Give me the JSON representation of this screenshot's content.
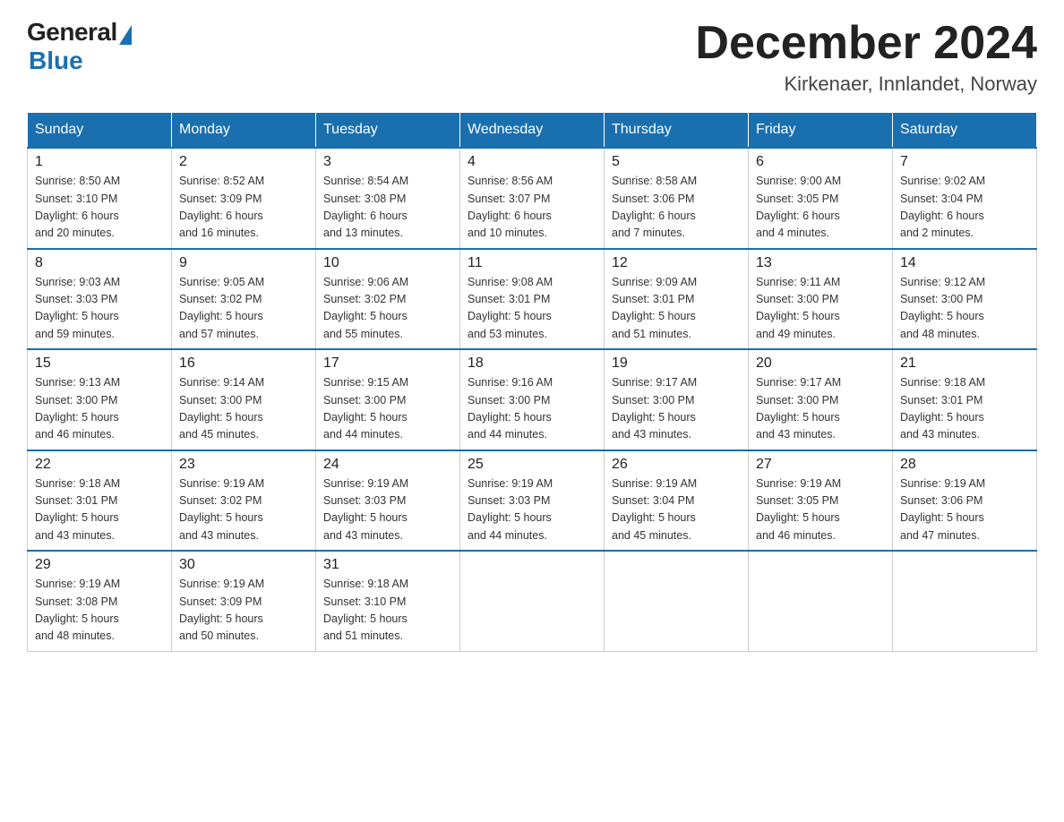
{
  "logo": {
    "general": "General",
    "blue": "Blue"
  },
  "title": "December 2024",
  "location": "Kirkenaer, Innlandet, Norway",
  "weekdays": [
    "Sunday",
    "Monday",
    "Tuesday",
    "Wednesday",
    "Thursday",
    "Friday",
    "Saturday"
  ],
  "weeks": [
    [
      {
        "day": "1",
        "info": "Sunrise: 8:50 AM\nSunset: 3:10 PM\nDaylight: 6 hours\nand 20 minutes."
      },
      {
        "day": "2",
        "info": "Sunrise: 8:52 AM\nSunset: 3:09 PM\nDaylight: 6 hours\nand 16 minutes."
      },
      {
        "day": "3",
        "info": "Sunrise: 8:54 AM\nSunset: 3:08 PM\nDaylight: 6 hours\nand 13 minutes."
      },
      {
        "day": "4",
        "info": "Sunrise: 8:56 AM\nSunset: 3:07 PM\nDaylight: 6 hours\nand 10 minutes."
      },
      {
        "day": "5",
        "info": "Sunrise: 8:58 AM\nSunset: 3:06 PM\nDaylight: 6 hours\nand 7 minutes."
      },
      {
        "day": "6",
        "info": "Sunrise: 9:00 AM\nSunset: 3:05 PM\nDaylight: 6 hours\nand 4 minutes."
      },
      {
        "day": "7",
        "info": "Sunrise: 9:02 AM\nSunset: 3:04 PM\nDaylight: 6 hours\nand 2 minutes."
      }
    ],
    [
      {
        "day": "8",
        "info": "Sunrise: 9:03 AM\nSunset: 3:03 PM\nDaylight: 5 hours\nand 59 minutes."
      },
      {
        "day": "9",
        "info": "Sunrise: 9:05 AM\nSunset: 3:02 PM\nDaylight: 5 hours\nand 57 minutes."
      },
      {
        "day": "10",
        "info": "Sunrise: 9:06 AM\nSunset: 3:02 PM\nDaylight: 5 hours\nand 55 minutes."
      },
      {
        "day": "11",
        "info": "Sunrise: 9:08 AM\nSunset: 3:01 PM\nDaylight: 5 hours\nand 53 minutes."
      },
      {
        "day": "12",
        "info": "Sunrise: 9:09 AM\nSunset: 3:01 PM\nDaylight: 5 hours\nand 51 minutes."
      },
      {
        "day": "13",
        "info": "Sunrise: 9:11 AM\nSunset: 3:00 PM\nDaylight: 5 hours\nand 49 minutes."
      },
      {
        "day": "14",
        "info": "Sunrise: 9:12 AM\nSunset: 3:00 PM\nDaylight: 5 hours\nand 48 minutes."
      }
    ],
    [
      {
        "day": "15",
        "info": "Sunrise: 9:13 AM\nSunset: 3:00 PM\nDaylight: 5 hours\nand 46 minutes."
      },
      {
        "day": "16",
        "info": "Sunrise: 9:14 AM\nSunset: 3:00 PM\nDaylight: 5 hours\nand 45 minutes."
      },
      {
        "day": "17",
        "info": "Sunrise: 9:15 AM\nSunset: 3:00 PM\nDaylight: 5 hours\nand 44 minutes."
      },
      {
        "day": "18",
        "info": "Sunrise: 9:16 AM\nSunset: 3:00 PM\nDaylight: 5 hours\nand 44 minutes."
      },
      {
        "day": "19",
        "info": "Sunrise: 9:17 AM\nSunset: 3:00 PM\nDaylight: 5 hours\nand 43 minutes."
      },
      {
        "day": "20",
        "info": "Sunrise: 9:17 AM\nSunset: 3:00 PM\nDaylight: 5 hours\nand 43 minutes."
      },
      {
        "day": "21",
        "info": "Sunrise: 9:18 AM\nSunset: 3:01 PM\nDaylight: 5 hours\nand 43 minutes."
      }
    ],
    [
      {
        "day": "22",
        "info": "Sunrise: 9:18 AM\nSunset: 3:01 PM\nDaylight: 5 hours\nand 43 minutes."
      },
      {
        "day": "23",
        "info": "Sunrise: 9:19 AM\nSunset: 3:02 PM\nDaylight: 5 hours\nand 43 minutes."
      },
      {
        "day": "24",
        "info": "Sunrise: 9:19 AM\nSunset: 3:03 PM\nDaylight: 5 hours\nand 43 minutes."
      },
      {
        "day": "25",
        "info": "Sunrise: 9:19 AM\nSunset: 3:03 PM\nDaylight: 5 hours\nand 44 minutes."
      },
      {
        "day": "26",
        "info": "Sunrise: 9:19 AM\nSunset: 3:04 PM\nDaylight: 5 hours\nand 45 minutes."
      },
      {
        "day": "27",
        "info": "Sunrise: 9:19 AM\nSunset: 3:05 PM\nDaylight: 5 hours\nand 46 minutes."
      },
      {
        "day": "28",
        "info": "Sunrise: 9:19 AM\nSunset: 3:06 PM\nDaylight: 5 hours\nand 47 minutes."
      }
    ],
    [
      {
        "day": "29",
        "info": "Sunrise: 9:19 AM\nSunset: 3:08 PM\nDaylight: 5 hours\nand 48 minutes."
      },
      {
        "day": "30",
        "info": "Sunrise: 9:19 AM\nSunset: 3:09 PM\nDaylight: 5 hours\nand 50 minutes."
      },
      {
        "day": "31",
        "info": "Sunrise: 9:18 AM\nSunset: 3:10 PM\nDaylight: 5 hours\nand 51 minutes."
      },
      null,
      null,
      null,
      null
    ]
  ]
}
